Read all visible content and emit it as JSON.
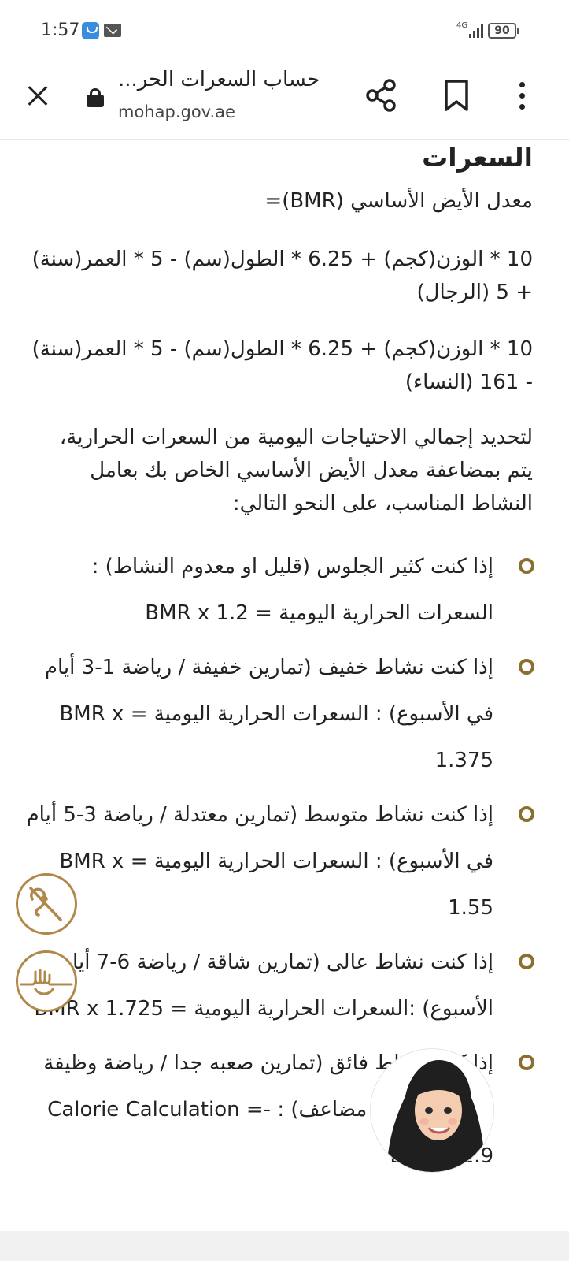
{
  "status_bar": {
    "time": "1:57",
    "network": "4G",
    "battery": "90"
  },
  "browser": {
    "page_title": "حساب السعرات الحر...",
    "url": "mohap.gov.ae"
  },
  "content": {
    "heading": "السعرات",
    "bmr_label": "معدل الأيض الأساسي (BMR)=",
    "formula_men": "10 * الوزن(كجم) + 6.25 * الطول(سم) - 5 * العمر(سنة) + 5 (الرجال)",
    "formula_women": "10 * الوزن(كجم) + 6.25 * الطول(سم) - 5 * العمر(سنة) - 161 (النساء)",
    "intro": "لتحديد إجمالي الاحتياجات اليومية من السعرات الحرارية، يتم بمضاعفة معدل الأيض الأساسي الخاص بك بعامل النشاط المناسب، على النحو التالي:",
    "activity_levels": [
      {
        "text": "إذا كنت كثير الجلوس (قليل او معدوم النشاط) : السعرات الحرارية اليومية = BMR x 1.2"
      },
      {
        "text": "إذا كنت نشاط خفيف (تمارين خفيفة / رياضة 1-3 أيام في الأسبوع) : السعرات الحرارية اليومية = BMR x 1.375"
      },
      {
        "text": "إذا كنت نشاط متوسط (تمارين معتدلة / رياضة 3-5 أيام في الأسبوع) : السعرات الحرارية اليومية = BMR x 1.55"
      },
      {
        "text": "إذا كنت نشاط عالى (تمارين شاقة / رياضة 6-7 أيام في الأسبوع) :السعرات الحرارية اليومية = BMR x 1.725"
      },
      {
        "text": "إذا كنت نشاط فائق (تمارين صعبه جدا / رياضة وظيفة بدنية أو تدريب مضاعف) : -Calorie Calculation = BMR x 1.9"
      }
    ]
  },
  "colors": {
    "accent": "#8b6f2e",
    "fab_border": "#b0884a"
  }
}
